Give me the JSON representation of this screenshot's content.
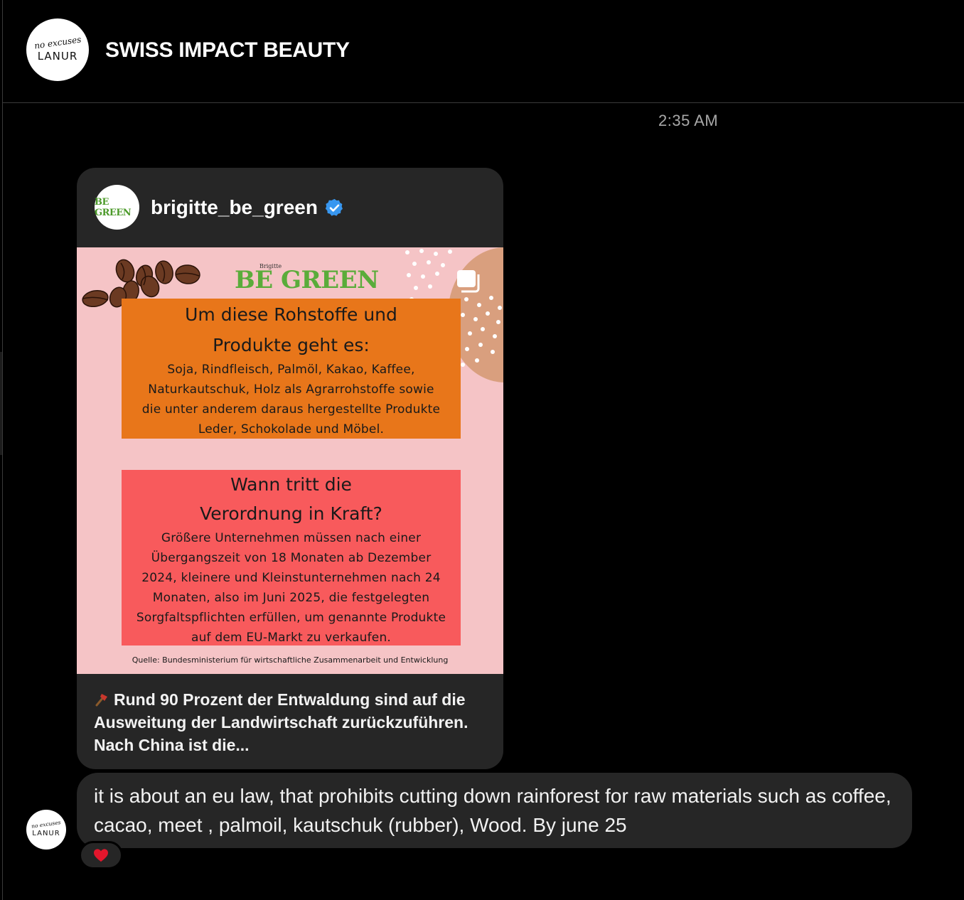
{
  "header": {
    "title": "SWISS IMPACT BEAUTY",
    "avatar_script": "no excuses",
    "avatar_brand": "LANUR"
  },
  "thread": {
    "timestamp": "2:35 AM"
  },
  "shared_post": {
    "username": "brigitte_be_green",
    "verified": true,
    "avatar_text": "BE GREEN",
    "image": {
      "logo_small": "Brigitte",
      "logo_main": "BE GREEN",
      "section1": {
        "heading_line1": "Um diese Rohstoffe und",
        "heading_line2": "Produkte geht es:",
        "body_lines": [
          "Soja, Rindfleisch, Palmöl, Kakao, Kaffee,",
          "Naturkautschuk, Holz als Agrarrohstoffe sowie",
          "die unter anderem daraus hergestellte Produkte",
          "Leder, Schokolade und Möbel."
        ]
      },
      "section2": {
        "heading_line1": "Wann tritt die",
        "heading_line2": "Verordnung in Kraft?",
        "body_lines": [
          "Größere Unternehmen müssen nach einer",
          "Übergangszeit von 18 Monaten ab Dezember",
          "2024, kleinere und Kleinstunternehmen nach 24",
          "Monaten, also im Juni 2025, die festgelegten",
          "Sorgfaltspflichten erfüllen, um genannte Produkte",
          "auf dem EU-Markt zu verkaufen."
        ]
      },
      "source": "Quelle: Bundesministerium für wirtschaftliche Zusammenarbeit und Entwicklung"
    },
    "caption": "Rund 90 Prozent der Entwaldung sind auf die Ausweitung der Landwirtschaft zurückzuführen. Nach China ist die..."
  },
  "message": {
    "text": "it is about an eu law, that prohibits cutting down rainforest for raw materials such as coffee, cacao, meet , palmoil, kautschuk (rubber), Wood. By june 25",
    "reaction": "heart",
    "reaction_color": "#e3162c"
  },
  "colors": {
    "background": "#000000",
    "bubble": "#262626",
    "verified": "#3897f0",
    "orange_box": "#e8761a",
    "red_box": "#f85a5c",
    "pink_bg": "#f5c4c6",
    "logo_green": "#5aac3a"
  }
}
